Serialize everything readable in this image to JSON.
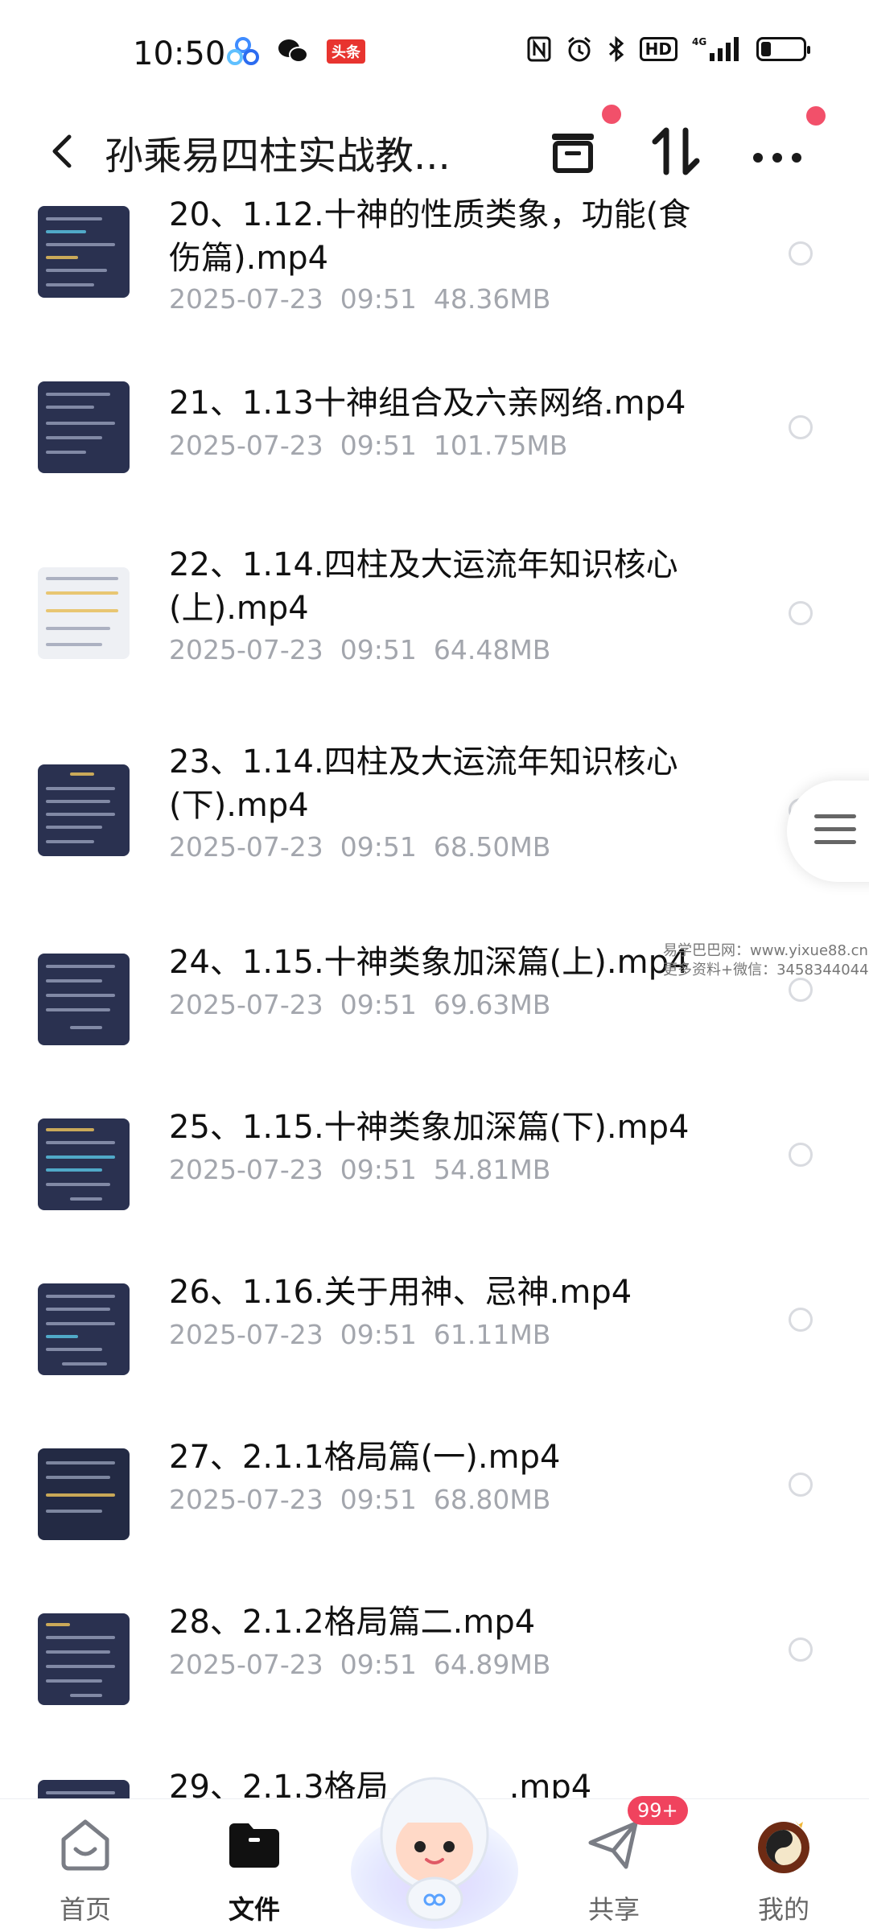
{
  "status_bar": {
    "time": "10:50",
    "app_badge": "头条",
    "network": "4G",
    "hd": "HD"
  },
  "header": {
    "title": "孙乘易四柱实战教...",
    "back_icon": "chevron-left-icon",
    "actions": [
      "archive-icon",
      "sort-icon",
      "more-icon"
    ]
  },
  "files": [
    {
      "name": "20、1.12.十神的性质类象，功能(食伤篇).mp4",
      "date": "2025-07-23",
      "time": "09:51",
      "size": "48.36MB"
    },
    {
      "name": "21、1.13十神组合及六亲网络.mp4",
      "date": "2025-07-23",
      "time": "09:51",
      "size": "101.75MB"
    },
    {
      "name": "22、1.14.四柱及大运流年知识核心(上).mp4",
      "date": "2025-07-23",
      "time": "09:51",
      "size": "64.48MB"
    },
    {
      "name": "23、1.14.四柱及大运流年知识核心(下).mp4",
      "date": "2025-07-23",
      "time": "09:51",
      "size": "68.50MB"
    },
    {
      "name": "24、1.15.十神类象加深篇(上).mp4",
      "date": "2025-07-23",
      "time": "09:51",
      "size": "69.63MB"
    },
    {
      "name": "25、1.15.十神类象加深篇(下).mp4",
      "date": "2025-07-23",
      "time": "09:51",
      "size": "54.81MB"
    },
    {
      "name": "26、1.16.关于用神、忌神.mp4",
      "date": "2025-07-23",
      "time": "09:51",
      "size": "61.11MB"
    },
    {
      "name": "27、2.1.1格局篇(一).mp4",
      "date": "2025-07-23",
      "time": "09:51",
      "size": "68.80MB"
    },
    {
      "name": "28、2.1.2格局篇二.mp4",
      "date": "2025-07-23",
      "time": "09:51",
      "size": "64.89MB"
    },
    {
      "name": "29、2.1.3格局",
      "suffix": ".mp4"
    }
  ],
  "watermark": {
    "line1": "易学巴巴网：www.yixue88.cn",
    "line2": "更多资料+微信：3458344044"
  },
  "bottom_nav": {
    "items": [
      {
        "label": "首页",
        "icon": "home-icon"
      },
      {
        "label": "文件",
        "icon": "folder-icon",
        "active": true
      },
      {
        "label": "共享",
        "icon": "paper-plane-icon",
        "badge": "99+"
      },
      {
        "label": "我的",
        "icon": "profile-avatar-icon"
      }
    ]
  }
}
